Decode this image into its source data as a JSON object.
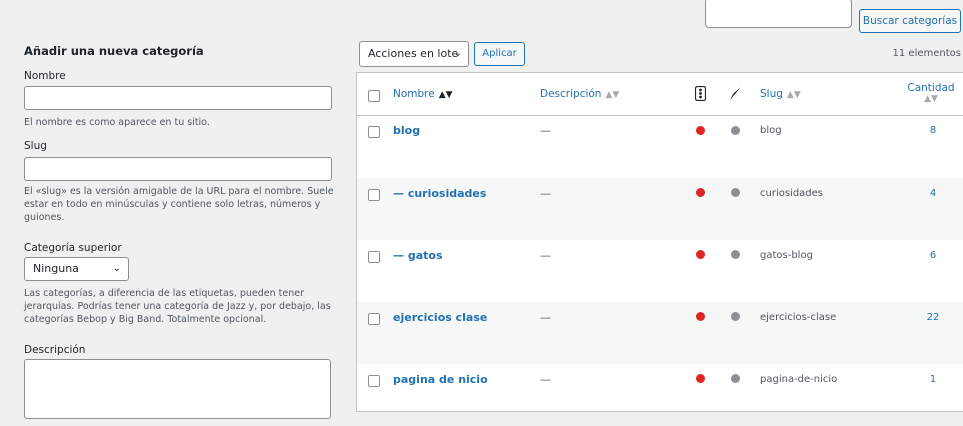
{
  "search": {
    "button_label": "Buscar categorías"
  },
  "form": {
    "title": "Añadir una nueva categoría",
    "name_label": "Nombre",
    "name_help": "El nombre es como aparece en tu sitio.",
    "slug_label": "Slug",
    "slug_help": "El «slug» es la versión amigable de la URL para el nombre. Suele estar en todo en minúsculas y contiene solo letras, números y guiones.",
    "parent_label": "Categoría superior",
    "parent_value": "Ninguna",
    "parent_help": "Las categorías, a diferencia de las etiquetas, pueden tener jerarquías. Podrías tener una categoría de Jazz y, por debajo, las categorías Bebop y Big Band. Totalmente opcional.",
    "description_label": "Descripción"
  },
  "toolbar": {
    "bulk_actions_label": "Acciones en lote",
    "apply_label": "Aplicar",
    "items_count": "11 elementos"
  },
  "table": {
    "headers": {
      "name": "Nombre",
      "description": "Descripción",
      "slug": "Slug",
      "count": "Cantidad"
    },
    "rows": [
      {
        "name": "blog",
        "description": "—",
        "slug": "blog",
        "count": "8"
      },
      {
        "name": "— curiosidades",
        "description": "—",
        "slug": "curiosidades",
        "count": "4"
      },
      {
        "name": "— gatos",
        "description": "—",
        "slug": "gatos-blog",
        "count": "6"
      },
      {
        "name": "ejercicios clase",
        "description": "—",
        "slug": "ejercicios-clase",
        "count": "22"
      },
      {
        "name": "pagina de nicio",
        "description": "—",
        "slug": "pagina-de-nicio",
        "count": "1"
      }
    ]
  },
  "colors": {
    "accent": "#2271b1",
    "status_red": "#e02424",
    "status_grey": "#8c8f94"
  }
}
